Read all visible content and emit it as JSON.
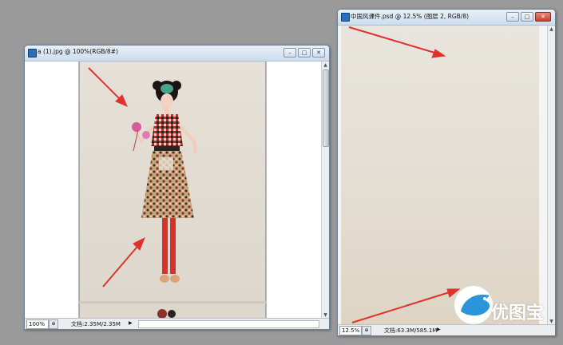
{
  "windows": {
    "left": {
      "title": "a (1).jpg @ 100%(RGB/8#)",
      "zoom": "100%",
      "doc_info": "文档:2.35M/2.35M"
    },
    "right": {
      "title": "中国风课件.psd @ 12.5% (图层 2, RGB/8)",
      "zoom": "12.5%",
      "doc_info": "文档:63.3M/585.1M"
    }
  },
  "controls": {
    "minimize": "–",
    "restore": "□",
    "close": "✕"
  },
  "watermark": {
    "cn": "优图宝",
    "en": "utobao.com"
  },
  "colors": {
    "arrow": "#e0312b",
    "canvas_bg": "#e8e3da",
    "brand": "#2a95d8"
  }
}
